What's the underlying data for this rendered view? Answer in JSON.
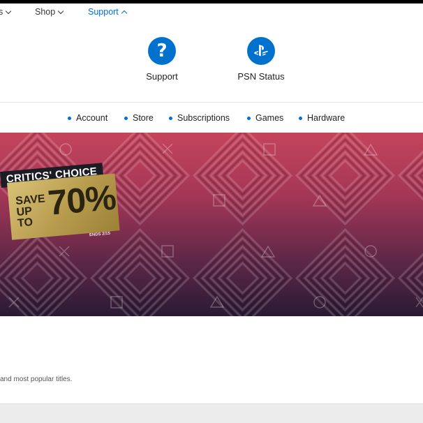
{
  "nav": {
    "items": [
      {
        "label": "s"
      },
      {
        "label": "Shop"
      },
      {
        "label": "Support"
      }
    ]
  },
  "dropdown": {
    "items": [
      {
        "label": "Support",
        "icon": "question-icon"
      },
      {
        "label": "PSN Status",
        "icon": "playstation-icon"
      }
    ]
  },
  "subnav": {
    "items": [
      {
        "label": "Account"
      },
      {
        "label": "Store"
      },
      {
        "label": "Subscriptions"
      },
      {
        "label": "Games"
      },
      {
        "label": "Hardware"
      }
    ]
  },
  "banner": {
    "title": "CRITICS' CHOICE",
    "save_label": "SAVE UP TO",
    "discount": "70%",
    "ends": "ENDS 2/15"
  },
  "content": {
    "text": "and most popular titles."
  },
  "colors": {
    "accent": "#0070d1",
    "icon_bg": "#0072ce",
    "banner_top": "#c5445c",
    "banner_bottom": "#2a1a34",
    "badge_gold": "#c9ae5e"
  }
}
